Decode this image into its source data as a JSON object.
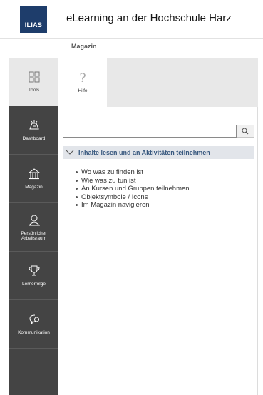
{
  "header": {
    "logo_text": "ILIAS",
    "title": "eLearning an der Hochschule Harz"
  },
  "breadcrumb": {
    "current": "Magazin"
  },
  "mainbar": {
    "items": [
      {
        "label": "Tools",
        "icon": "grid-icon",
        "active": true
      },
      {
        "label": "Dashboard",
        "icon": "dashboard-icon",
        "active": false
      },
      {
        "label": "Magazin",
        "icon": "bank-icon",
        "active": false
      },
      {
        "label": "Persönlicher Arbeitsraum",
        "icon": "user-icon",
        "active": false
      },
      {
        "label": "Lernerfolge",
        "icon": "trophy-icon",
        "active": false
      },
      {
        "label": "Kommunikation",
        "icon": "chat-icon",
        "active": false
      }
    ]
  },
  "tools": {
    "tab_label": "Hilfe",
    "tab_icon": "?"
  },
  "help": {
    "search_value": "",
    "search_placeholder": "",
    "section_title": "Inhalte lesen und an Aktivitäten teilnehmen",
    "links": [
      "Wo was zu finden ist",
      "Wie was zu tun ist",
      "An Kursen und Gruppen teilnehmen",
      "Objektsymbole / Icons",
      "Im Magazin navigieren"
    ]
  },
  "colors": {
    "mainbar_bg": "#444444",
    "active_bg": "#e8e8e8",
    "logo_bg": "#1e3d6b",
    "accordion_bg": "#e2e5ea",
    "accordion_text": "#3a5a80"
  }
}
